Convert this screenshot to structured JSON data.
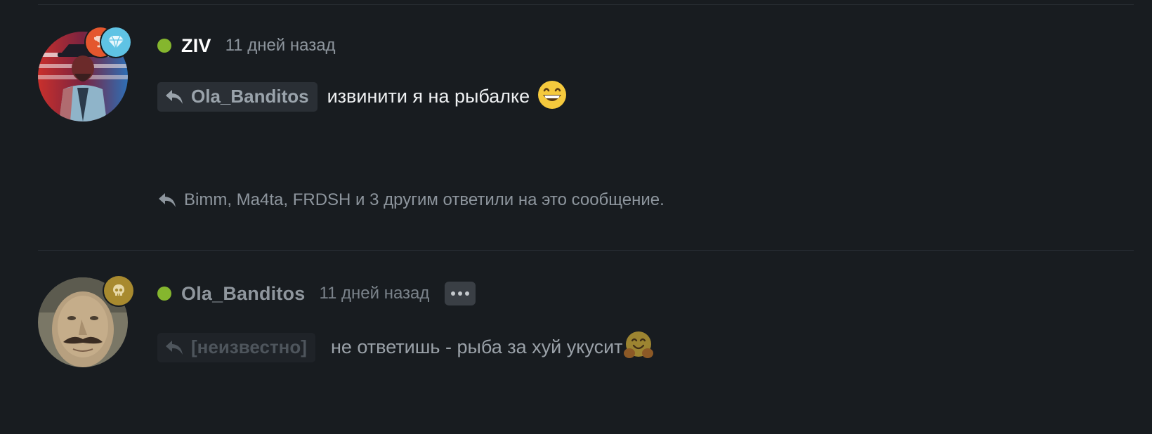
{
  "posts": [
    {
      "username": "ZIV",
      "timestamp": "11 дней назад",
      "reply_to": "Ola_Banditos",
      "message": "извинити я на рыбалке",
      "message_emoji": "grinning-face-emoji",
      "badges": [
        "trophy-badge-icon",
        "diamond-badge-icon"
      ],
      "replies_summary": "Bimm, Ma4ta, FRDSH и 3 другим ответили на это сообщение.",
      "online_color": "#85b62e"
    },
    {
      "username": "Ola_Banditos",
      "timestamp": "11 дней назад",
      "reply_to": "[неизвестно]",
      "message": "не ответишь - рыба за хуй укусит",
      "message_emoji": "hugging-face-emoji",
      "badges": [
        "skull-badge-icon"
      ],
      "online_color": "#85b62e"
    }
  ],
  "colors": {
    "background": "#181c20",
    "chip": "#2a2f35",
    "muted_text": "#8d959d",
    "online": "#85b62e"
  }
}
